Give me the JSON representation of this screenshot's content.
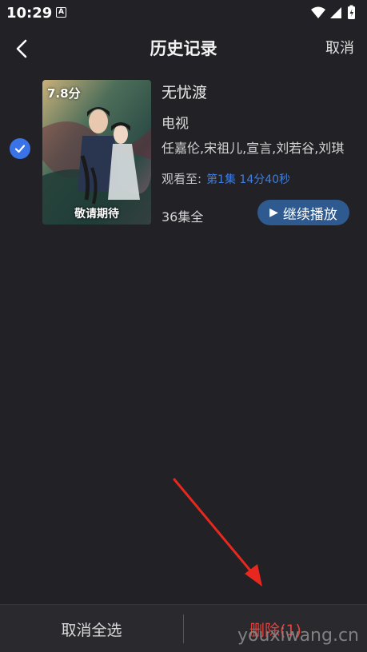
{
  "status_bar": {
    "time": "10:29",
    "a_badge": "A"
  },
  "header": {
    "title": "历史记录",
    "cancel_label": "取消"
  },
  "item": {
    "score": "7.8分",
    "poster_caption": "敬请期待",
    "title": "无忧渡",
    "type": "电视",
    "cast": "任嘉伦,宋祖儿,宣言,刘若谷,刘琪",
    "progress_label": "观看至:",
    "progress_value": "第1集 14分40秒",
    "episodes": "36集全",
    "resume_label": "继续播放",
    "selected": true
  },
  "bottom_bar": {
    "deselect_label": "取消全选",
    "delete_label": "删除(1)"
  },
  "watermark": "youxiwang.cn",
  "colors": {
    "accent_blue": "#3a72e8",
    "delete_red": "#e8403a",
    "resume_bg": "#2e5a8f",
    "arrow_red": "#e8281e"
  }
}
